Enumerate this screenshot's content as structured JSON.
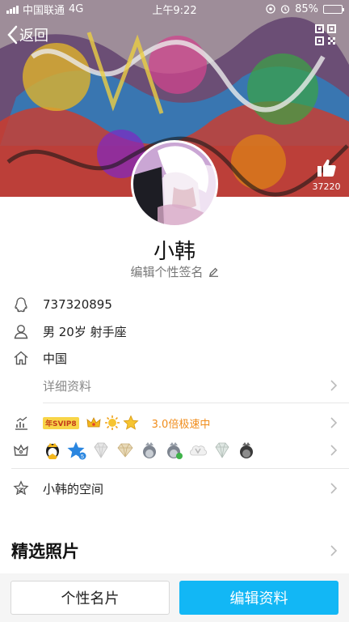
{
  "status_bar": {
    "carrier": "中国联通",
    "network": "4G",
    "time": "上午9:22",
    "battery": "85%",
    "battery_level": 0.85
  },
  "nav": {
    "back_label": "返回",
    "back_icon": "chevron-left-icon",
    "qr_icon": "qr-code-icon"
  },
  "profile": {
    "likes": "37220",
    "nickname": "小韩",
    "signature_prompt": "编辑个性签名"
  },
  "info": {
    "qq_number": "737320895",
    "personal": "男  20岁  射手座",
    "location": "中国",
    "detail_label": "详细资料"
  },
  "level": {
    "svip_badge": "年SVIP8",
    "speed_text": "3.0倍极速中"
  },
  "qzone_label": "小韩的空间",
  "photos_title": "精选照片",
  "buttons": {
    "card": "个性名片",
    "edit": "编辑资料"
  },
  "colors": {
    "accent": "#12b7f5",
    "speed": "#f08c1a",
    "svip_bg": "#f8d548"
  }
}
